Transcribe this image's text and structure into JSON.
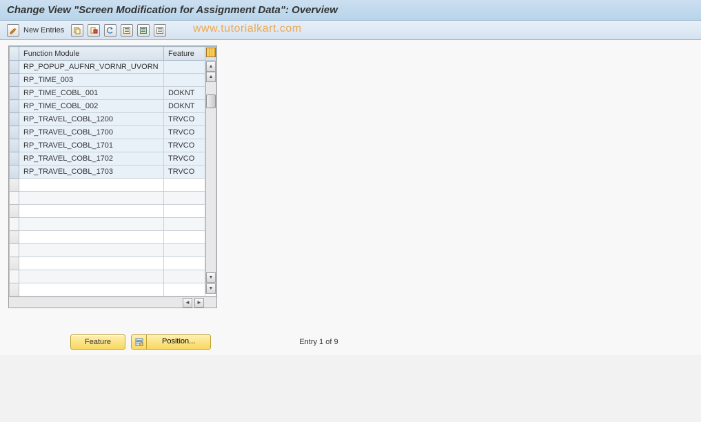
{
  "title": "Change View \"Screen Modification for Assignment Data\": Overview",
  "toolbar": {
    "new_entries": "New Entries"
  },
  "watermark": "www.tutorialkart.com",
  "table": {
    "headers": {
      "col1": "Function Module",
      "col2": "Feature"
    },
    "rows": [
      {
        "fm": "RP_POPUP_AUFNR_VORNR_UVORN",
        "feat": ""
      },
      {
        "fm": "RP_TIME_003",
        "feat": ""
      },
      {
        "fm": "RP_TIME_COBL_001",
        "feat": "DOKNT"
      },
      {
        "fm": "RP_TIME_COBL_002",
        "feat": "DOKNT"
      },
      {
        "fm": "RP_TRAVEL_COBL_1200",
        "feat": "TRVCO"
      },
      {
        "fm": "RP_TRAVEL_COBL_1700",
        "feat": "TRVCO"
      },
      {
        "fm": "RP_TRAVEL_COBL_1701",
        "feat": "TRVCO"
      },
      {
        "fm": "RP_TRAVEL_COBL_1702",
        "feat": "TRVCO"
      },
      {
        "fm": "RP_TRAVEL_COBL_1703",
        "feat": "TRVCO"
      }
    ],
    "empty_rows": 9
  },
  "footer": {
    "feature_btn": "Feature",
    "position_btn": "Position...",
    "entry_text": "Entry 1 of 9"
  }
}
